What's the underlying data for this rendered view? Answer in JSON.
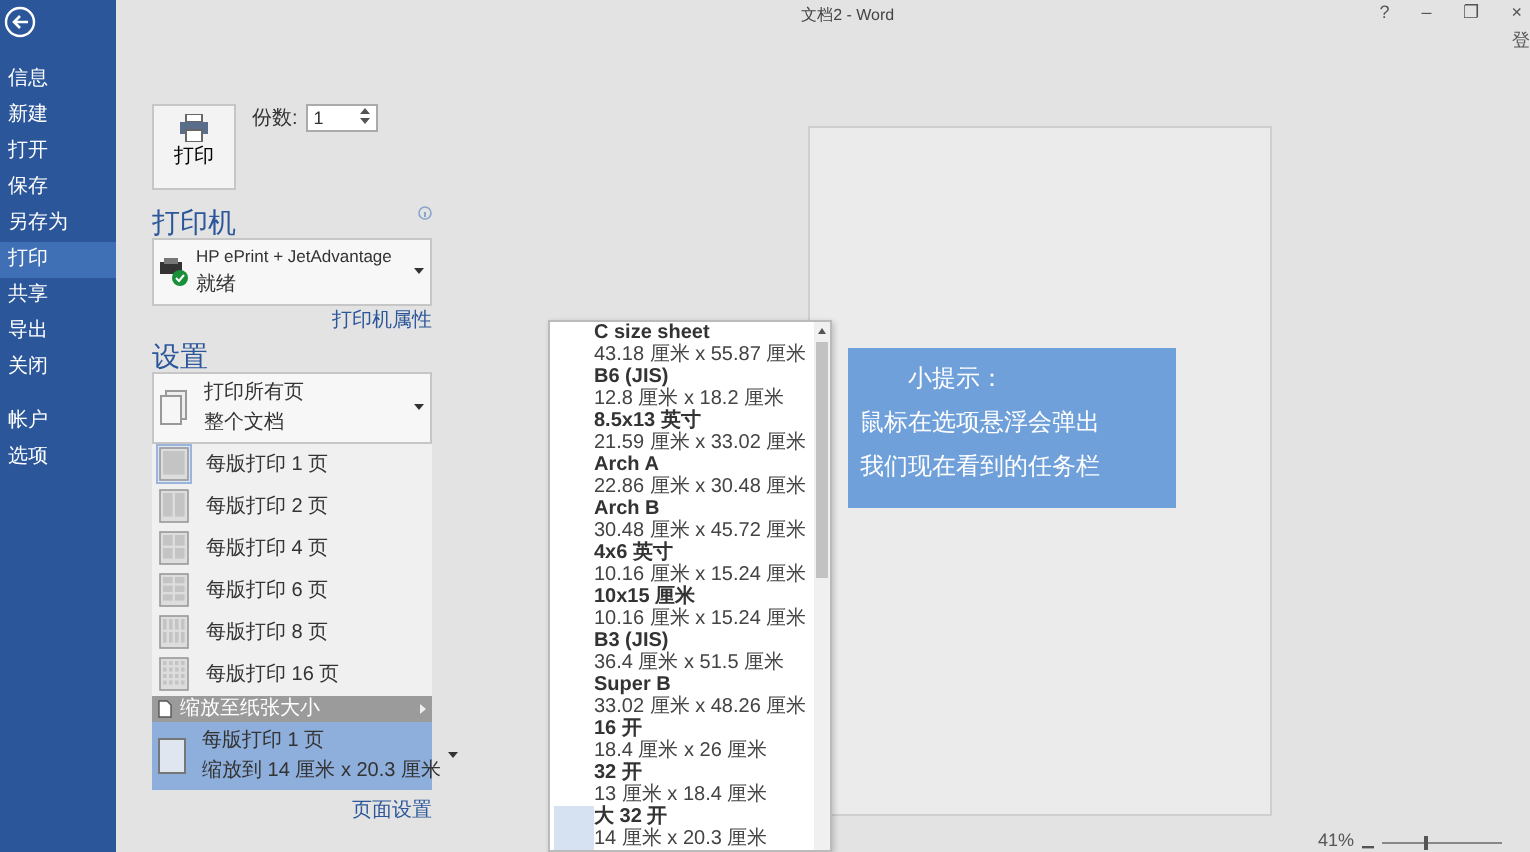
{
  "window": {
    "title": "文档2 - Word",
    "controls": [
      "?",
      "–",
      "❐",
      "×"
    ],
    "signin": "登"
  },
  "sidebar": {
    "items": [
      {
        "label": "信息",
        "selected": false
      },
      {
        "label": "新建",
        "selected": false
      },
      {
        "label": "打开",
        "selected": false
      },
      {
        "label": "保存",
        "selected": false
      },
      {
        "label": "另存为",
        "selected": false
      },
      {
        "label": "打印",
        "selected": true
      },
      {
        "label": "共享",
        "selected": false
      },
      {
        "label": "导出",
        "selected": false
      },
      {
        "label": "关闭",
        "selected": false
      }
    ],
    "lower_items": [
      {
        "label": "帐户",
        "selected": false
      },
      {
        "label": "选项",
        "selected": false
      }
    ]
  },
  "print": {
    "button": "打印",
    "copies_label": "份数:",
    "copies": "1"
  },
  "printer": {
    "heading": "打印机",
    "name": "HP ePrint + JetAdvantage",
    "status": "就绪",
    "properties_link": "打印机属性"
  },
  "settings": {
    "heading": "设置",
    "pages": {
      "title": "打印所有页",
      "subtitle": "整个文档"
    },
    "per_sheet_options": [
      {
        "label": "每版打印 1 页",
        "selected": true
      },
      {
        "label": "每版打印 2 页",
        "selected": false
      },
      {
        "label": "每版打印 4 页",
        "selected": false
      },
      {
        "label": "每版打印 6 页",
        "selected": false
      },
      {
        "label": "每版打印 8 页",
        "selected": false
      },
      {
        "label": "每版打印 16 页",
        "selected": false
      }
    ],
    "scale_item": {
      "label": "缩放至纸张大小",
      "highlighted": true
    },
    "pages_per_sheet": {
      "title": "每版打印 1 页",
      "subtitle": "缩放到 14 厘米 x 20.3 厘米"
    },
    "page_setup_link": "页面设置"
  },
  "paper_sizes": [
    {
      "name": "C size sheet",
      "size": "43.18 厘米 x 55.87 厘米",
      "selected": false
    },
    {
      "name": "B6 (JIS)",
      "size": "12.8 厘米 x 18.2 厘米",
      "selected": false
    },
    {
      "name": "8.5x13 英寸",
      "size": "21.59 厘米 x 33.02 厘米",
      "selected": false
    },
    {
      "name": "Arch A",
      "size": "22.86 厘米 x 30.48 厘米",
      "selected": false
    },
    {
      "name": "Arch B",
      "size": "30.48 厘米 x 45.72 厘米",
      "selected": false
    },
    {
      "name": "4x6 英寸",
      "size": "10.16 厘米 x 15.24 厘米",
      "selected": false
    },
    {
      "name": "10x15 厘米",
      "size": "10.16 厘米 x 15.24 厘米",
      "selected": false
    },
    {
      "name": "B3 (JIS)",
      "size": "36.4 厘米 x 51.5 厘米",
      "selected": false
    },
    {
      "name": "Super B",
      "size": "33.02 厘米 x 48.26 厘米",
      "selected": false
    },
    {
      "name": "16 开",
      "size": "18.4 厘米 x 26 厘米",
      "selected": false
    },
    {
      "name": "32 开",
      "size": "13 厘米 x 18.4 厘米",
      "selected": false
    },
    {
      "name": "大 32 开",
      "size": "14 厘米 x 20.3 厘米",
      "selected": true
    }
  ],
  "tip": {
    "title": "小提示：",
    "lines": [
      "鼠标在选项悬浮会弹出",
      "我们现在看到的任务栏"
    ]
  },
  "zoom": {
    "percent": "41%",
    "level": 0.35
  }
}
